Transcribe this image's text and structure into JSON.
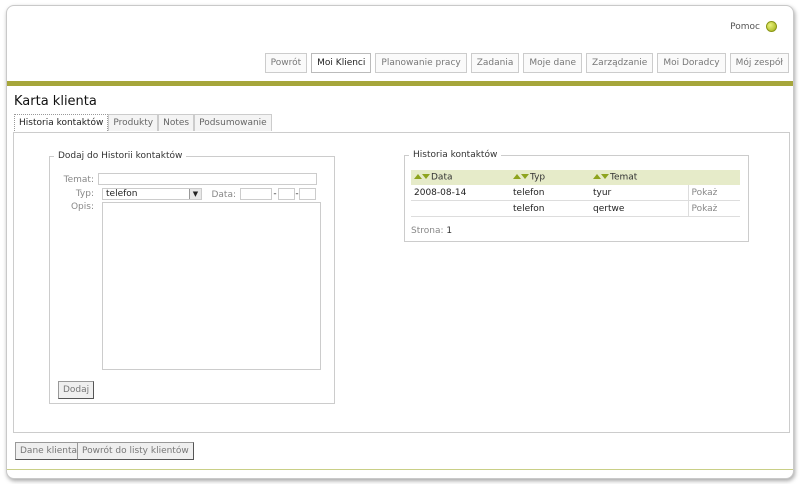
{
  "header": {
    "help_label": "Pomoc"
  },
  "nav": {
    "items": [
      {
        "label": "Powrót"
      },
      {
        "label": "Moi Klienci"
      },
      {
        "label": "Planowanie pracy"
      },
      {
        "label": "Zadania"
      },
      {
        "label": "Moje dane"
      },
      {
        "label": "Zarządzanie"
      },
      {
        "label": "Moi Doradcy"
      },
      {
        "label": "Mój zespół"
      }
    ],
    "active": "Moi Klienci"
  },
  "page": {
    "title": "Karta klienta"
  },
  "tabs": [
    {
      "label": "Historia kontaktów"
    },
    {
      "label": "Produkty"
    },
    {
      "label": "Notes"
    },
    {
      "label": "Podsumowanie"
    }
  ],
  "form": {
    "legend": "Dodaj do Historii kontaktów",
    "temat_label": "Temat:",
    "temat_value": "",
    "typ_label": "Typ:",
    "typ_value": "telefon",
    "data_label": "Data:",
    "date_sep1": "-",
    "date_sep2": "-",
    "opis_label": "Opis:",
    "submit_label": "Dodaj"
  },
  "history": {
    "legend": "Historia kontaktów",
    "columns": [
      "Data",
      "Typ",
      "Temat"
    ],
    "rows": [
      {
        "data": "2008-08-14",
        "typ": "telefon",
        "temat": "tyur",
        "action": "Pokaż"
      },
      {
        "data": "",
        "typ": "telefon",
        "temat": "qertwe",
        "action": "Pokaż"
      }
    ],
    "pager_label": "Strona:",
    "pager_value": "1"
  },
  "footer": {
    "client_data_label": "Dane klienta",
    "back_to_list_label": "Powrót do listy klientów"
  },
  "colors": {
    "accent_bar": "#a6a63b",
    "table_header": "#e6ebc9",
    "sort_arrow": "#8ea41f"
  }
}
